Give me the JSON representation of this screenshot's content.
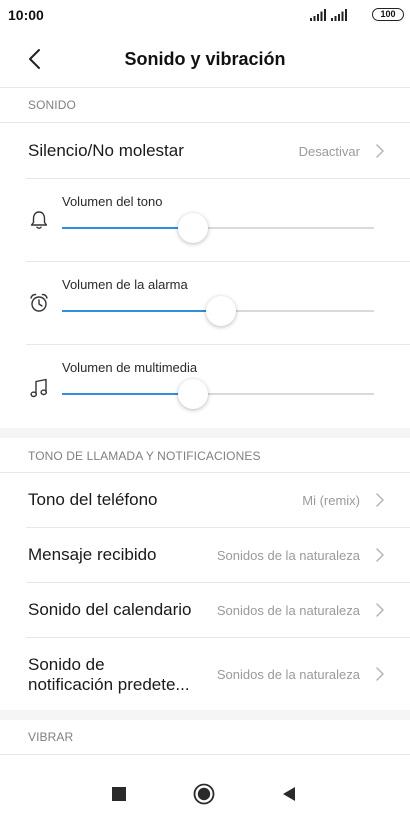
{
  "status_bar": {
    "time": "10:00",
    "battery": "100"
  },
  "header": {
    "title": "Sonido y vibración"
  },
  "sections": {
    "sound": {
      "label": "SONIDO"
    },
    "ringtones": {
      "label": "TONO DE LLAMADA Y NOTIFICACIONES"
    },
    "vibrate": {
      "label": "VIBRAR"
    }
  },
  "silence": {
    "title": "Silencio/No molestar",
    "value": "Desactivar"
  },
  "sliders": [
    {
      "label": "Volumen del tono",
      "icon": "bell-icon",
      "level": 0.42
    },
    {
      "label": "Volumen de la alarma",
      "icon": "alarm-clock-icon",
      "level": 0.51
    },
    {
      "label": "Volumen de multimedia",
      "icon": "music-note-icon",
      "level": 0.42
    }
  ],
  "ringtone_rows": [
    {
      "title": "Tono del teléfono",
      "value": "Mi (remix)"
    },
    {
      "title": "Mensaje recibido",
      "value": "Sonidos de la naturaleza"
    },
    {
      "title": "Sonido del calendario",
      "value": "Sonidos de la naturaleza"
    },
    {
      "title_line1": "Sonido de",
      "title_line2": "notificación predete...",
      "value": "Sonidos de la naturaleza"
    }
  ],
  "colors": {
    "accent": "#2e8fe0",
    "section_gap": "#f5f5f5",
    "secondary_text": "#9a9a9a"
  }
}
